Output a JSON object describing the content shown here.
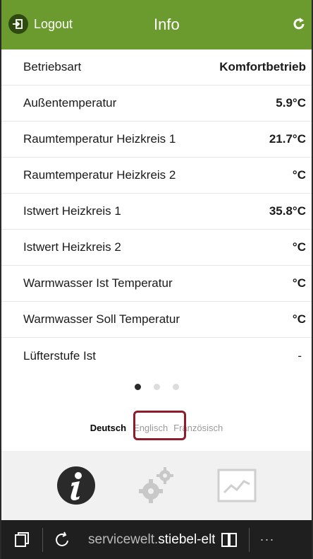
{
  "header": {
    "logout_label": "Logout",
    "title": "Info",
    "background": "#6b9a2e"
  },
  "info_rows": [
    {
      "label": "Betriebsart",
      "value": "Komfortbetrieb"
    },
    {
      "label": "Außentemperatur",
      "value": "5.9°C"
    },
    {
      "label": "Raumtemperatur Heizkreis 1",
      "value": "21.7°C"
    },
    {
      "label": "Raumtemperatur Heizkreis 2",
      "value": "°C"
    },
    {
      "label": "Istwert Heizkreis 1",
      "value": "35.8°C"
    },
    {
      "label": "Istwert Heizkreis 2",
      "value": "°C"
    },
    {
      "label": "Warmwasser Ist Temperatur",
      "value": "°C"
    },
    {
      "label": "Warmwasser Soll Temperatur",
      "value": "°C"
    },
    {
      "label": "Lüfterstufe Ist",
      "value": "-"
    }
  ],
  "pager": {
    "count": 3,
    "active_index": 0
  },
  "languages": {
    "items": [
      "Deutsch",
      "Englisch",
      "Französisch"
    ],
    "selected": "Deutsch",
    "highlighted": "Englisch",
    "highlight_color": "#8e1c2a"
  },
  "footer_nav": {
    "items": [
      "info-icon",
      "settings-gears-icon",
      "chart-icon"
    ],
    "active": "info-icon"
  },
  "browser_bar": {
    "url_prefix": "servicewelt.",
    "url_domain": "stiebel-eltro",
    "more_label": "···"
  }
}
